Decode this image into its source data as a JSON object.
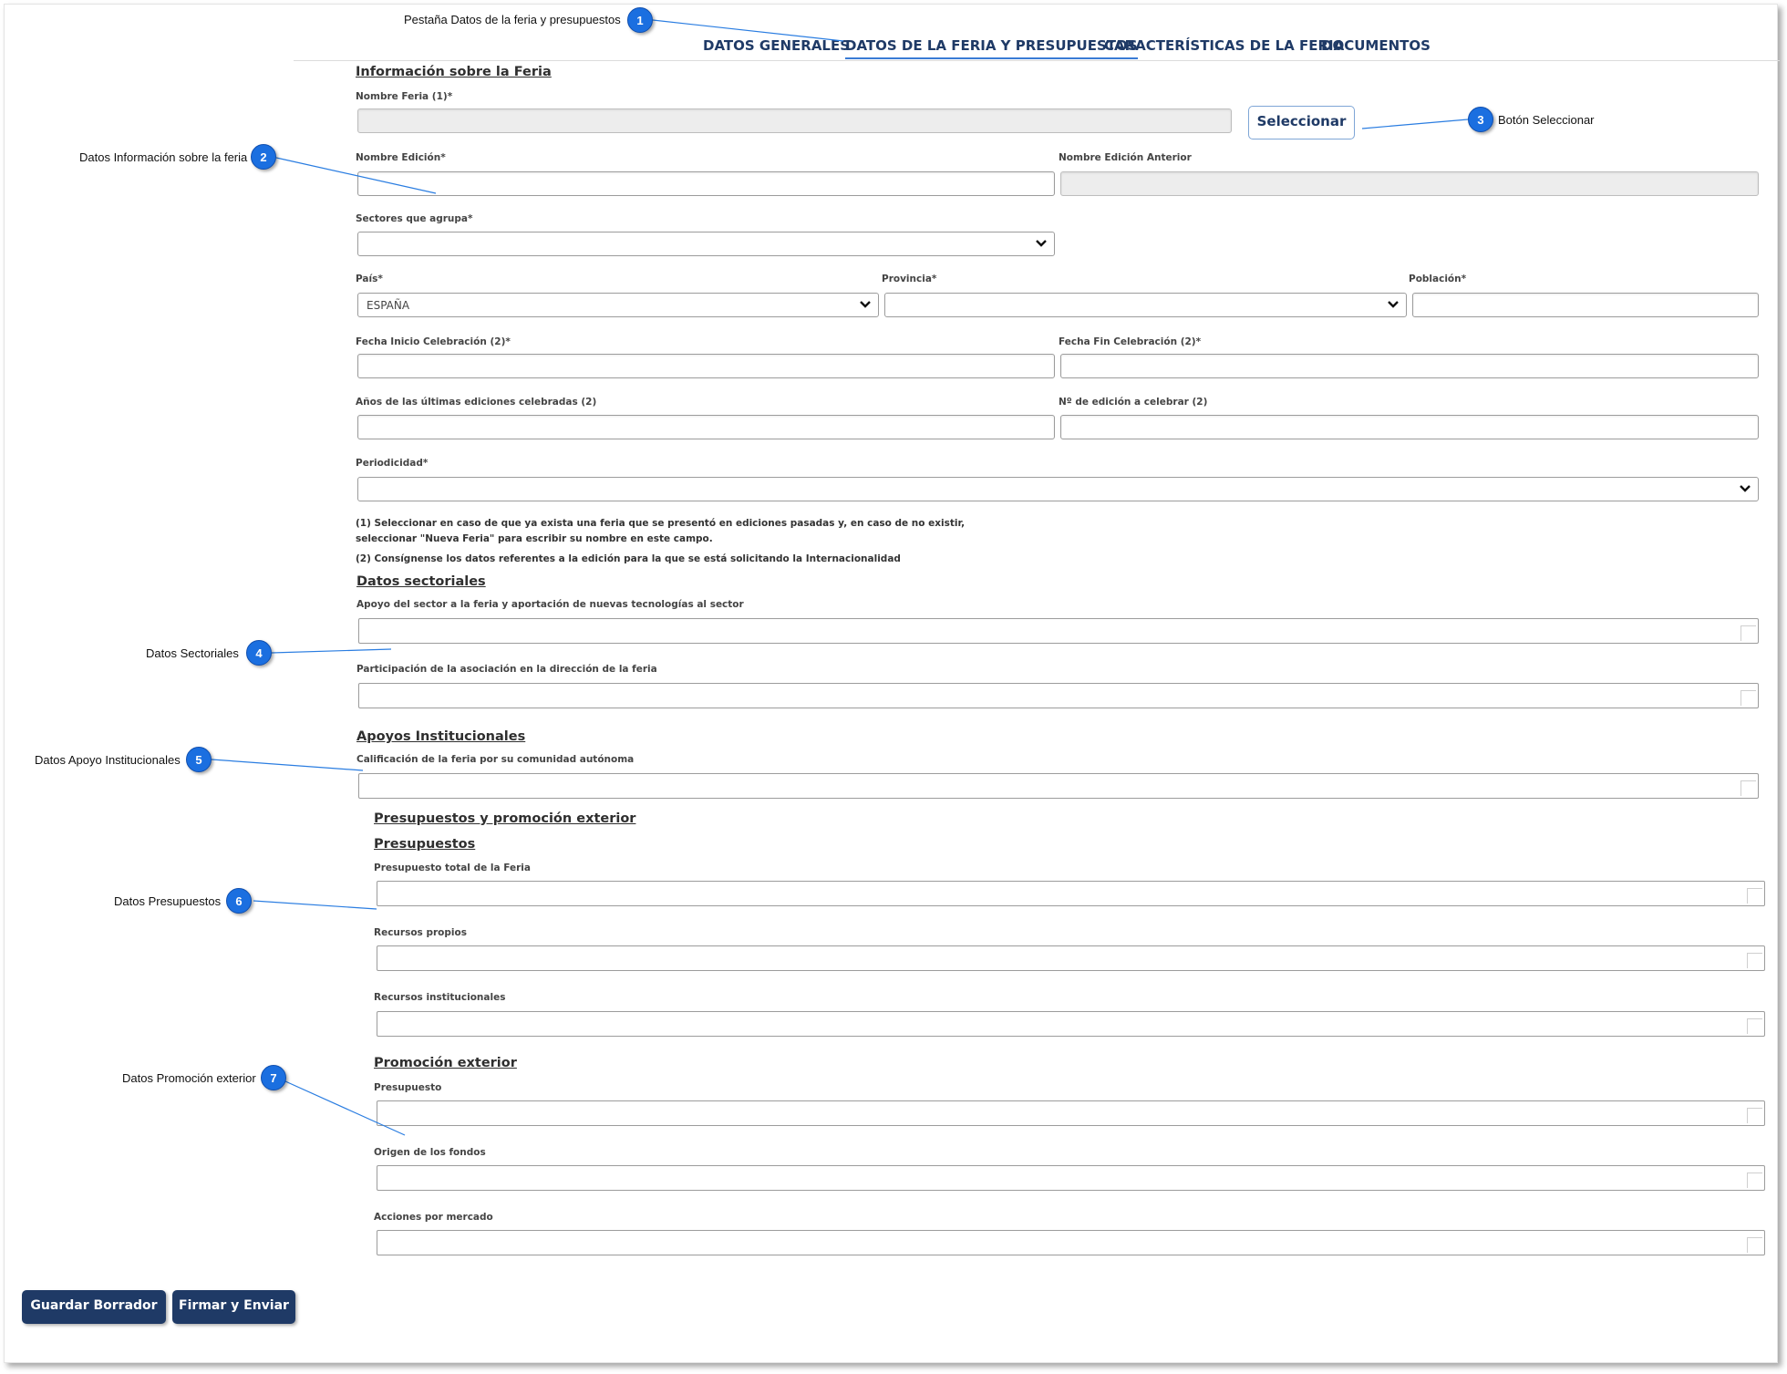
{
  "tabs": [
    {
      "label": "DATOS GENERALES"
    },
    {
      "label": "DATOS DE LA FERIA Y PRESUPUESTOS"
    },
    {
      "label": "CARACTERÍSTICAS DE LA FERIA"
    },
    {
      "label": "DOCUMENTOS"
    }
  ],
  "sections": {
    "info_feria": "Información sobre la Feria",
    "datos_sectoriales": "Datos sectoriales",
    "apoyos_institucionales": "Apoyos Institucionales",
    "presupuestos_promocion": "Presupuestos y promoción exterior",
    "presupuestos": "Presupuestos",
    "promocion_exterior": "Promoción exterior"
  },
  "fields": {
    "nombre_feria": "Nombre Feria (1)*",
    "nombre_edicion": "Nombre Edición*",
    "nombre_edicion_anterior": "Nombre Edición Anterior",
    "sectores": "Sectores que agrupa*",
    "pais": "País*",
    "pais_value": "ESPAÑA",
    "provincia": "Provincia*",
    "poblacion": "Población*",
    "fecha_inicio": "Fecha Inicio Celebración (2)*",
    "fecha_fin": "Fecha Fin Celebración (2)*",
    "anos_ediciones": "Años de las últimas ediciones celebradas (2)",
    "num_edicion": "Nº de edición a celebrar (2)",
    "periodicidad": "Periodicidad*",
    "apoyo_sector": "Apoyo del sector a la feria y aportación de nuevas tecnologías al sector",
    "participacion_asociacion": "Participación de la asociación en la dirección de la feria",
    "calificacion": "Calificación de la feria por su comunidad autónoma",
    "presupuesto_total": "Presupuesto total de la Feria",
    "recursos_propios": "Recursos propios",
    "recursos_institucionales": "Recursos institucionales",
    "presupuesto": "Presupuesto",
    "origen_fondos": "Origen de los fondos",
    "acciones_mercado": "Acciones por mercado"
  },
  "notes": {
    "note1_line1": "(1) Seleccionar en caso de que ya exista una feria que se presentó en ediciones pasadas y, en caso de no existir,",
    "note1_line2": "seleccionar \"Nueva Feria\" para escribir su nombre en este campo.",
    "note2": "(2) Consígnense los datos referentes a la edición para la que se está solicitando la Internacionalidad"
  },
  "buttons": {
    "seleccionar": "Seleccionar",
    "guardar_borrador": "Guardar Borrador",
    "firmar_enviar": "Firmar y Enviar"
  },
  "callouts": [
    {
      "number": "1",
      "text": "Pestaña Datos de la feria y presupuestos"
    },
    {
      "number": "2",
      "text": "Datos Información sobre la feria"
    },
    {
      "number": "3",
      "text": "Botón Seleccionar"
    },
    {
      "number": "4",
      "text": "Datos Sectoriales"
    },
    {
      "number": "5",
      "text": "Datos Apoyo Institucionales"
    },
    {
      "number": "6",
      "text": "Datos Presupuestos"
    },
    {
      "number": "7",
      "text": "Datos Promoción exterior"
    }
  ],
  "colors": {
    "tab_text": "#1f3a66",
    "tab_active_underline": "#3a7bd5",
    "button_primary": "#1f3a66",
    "callout_badge": "#1b6fe0"
  }
}
